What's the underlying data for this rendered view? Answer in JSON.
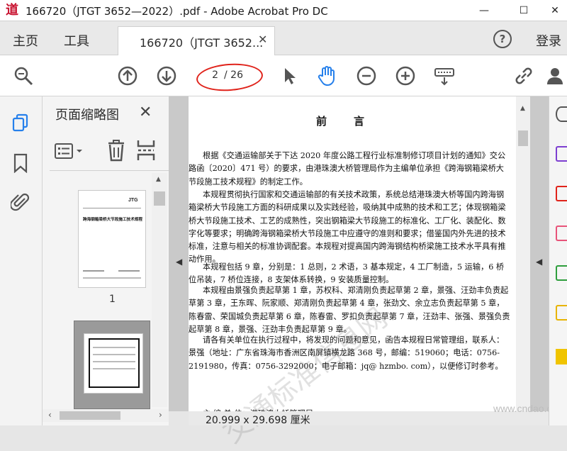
{
  "window": {
    "title": "166720（JTGT 3652—2022）.pdf - Adobe Acrobat Pro DC",
    "app_icon_glyph": "道",
    "minimize": "—",
    "maximize": "☐",
    "close": "✕"
  },
  "menu": {
    "home": "主页",
    "tools": "工具",
    "tab_label": "166720（JTGT 3652...",
    "tab_close": "✕",
    "help": "?",
    "login": "登录"
  },
  "toolbar": {
    "current_page": "2",
    "page_total": "/ 26"
  },
  "thumbnails": {
    "title": "页面缩略图",
    "close": "✕",
    "page1_number": "1",
    "page1_badge": "JTG",
    "page1_heading": "跨海钢箱梁桥大节段施工技术规程"
  },
  "document": {
    "heading": "前言",
    "paragraphs": [
      "根据《交通运输部关于下达 2020 年度公路工程行业标准制修订项目计划的通知》交公路函〔2020〕471 号）的要求，由港珠澳大桥管理局作为主编单位承担《跨海钢箱梁桥大节段施工技术规程》的制定工作。",
      "本规程贯彻执行国家和交通运输部的有关技术政策，系统总结港珠澳大桥等国内跨海钢箱梁桥大节段施工方面的科研成果以及实践经验，吸纳其中成熟的技术和工艺；体现钢箱梁桥大节段施工技术、工艺的成熟性，突出钢箱梁大节段施工的标准化、工厂化、装配化、数字化等要求；明确跨海钢箱梁桥大节段施工中应遵守的准则和要求；借鉴国内外先进的技术标准，注意与相关的标准协调配套。本规程对提高国内跨海钢结构桥梁施工技术水平具有推动作用。",
      "本规程包括 9 章，分别是：1 总则，2 术语，3 基本规定，4 工厂制造，5 运输，6 桥位吊装，7 桥位连接，8 支架体系转换，9 安装质量控制。",
      "本规程由景强负责起草第 1 章，苏权科、郑清刚负责起草第 2 章，景强、汪劲丰负责起草第 3 章，王东晖、阮家顺、郑清刚负责起草第 4 章，张劲文、余立志负责起草第 5 章，陈春雷、荣国城负责起草第 6 章，陈春雷、罗扣负责起草第 7 章，汪劲丰、张强、景强负责起草第 8 章，景强、汪劲丰负责起草第 9 章。",
      "请各有关单位在执行过程中，将发现的问题和意见，函告本规程日常管理组，联系人：景强（地址：广东省珠海市香洲区南屏镇横龙路 368 号，邮编：519060；电话：0756-2191980，传真：0756-3292000；电子邮箱：jq@ hzmbo. com），以便修订时参考。",
      "主 编 单 位：港珠澳大桥管理局"
    ]
  },
  "status": {
    "page_size": "20.999 x 29.698 厘米"
  },
  "watermarks": {
    "doc_wm": "交通标准信息网",
    "site": "www.cndao.com"
  },
  "colors": {
    "annotation_red": "#e0231b",
    "acrobat_blue": "#2680eb",
    "toolbar_bg": "#ffffff",
    "menu_bg": "#e9e9e9"
  }
}
